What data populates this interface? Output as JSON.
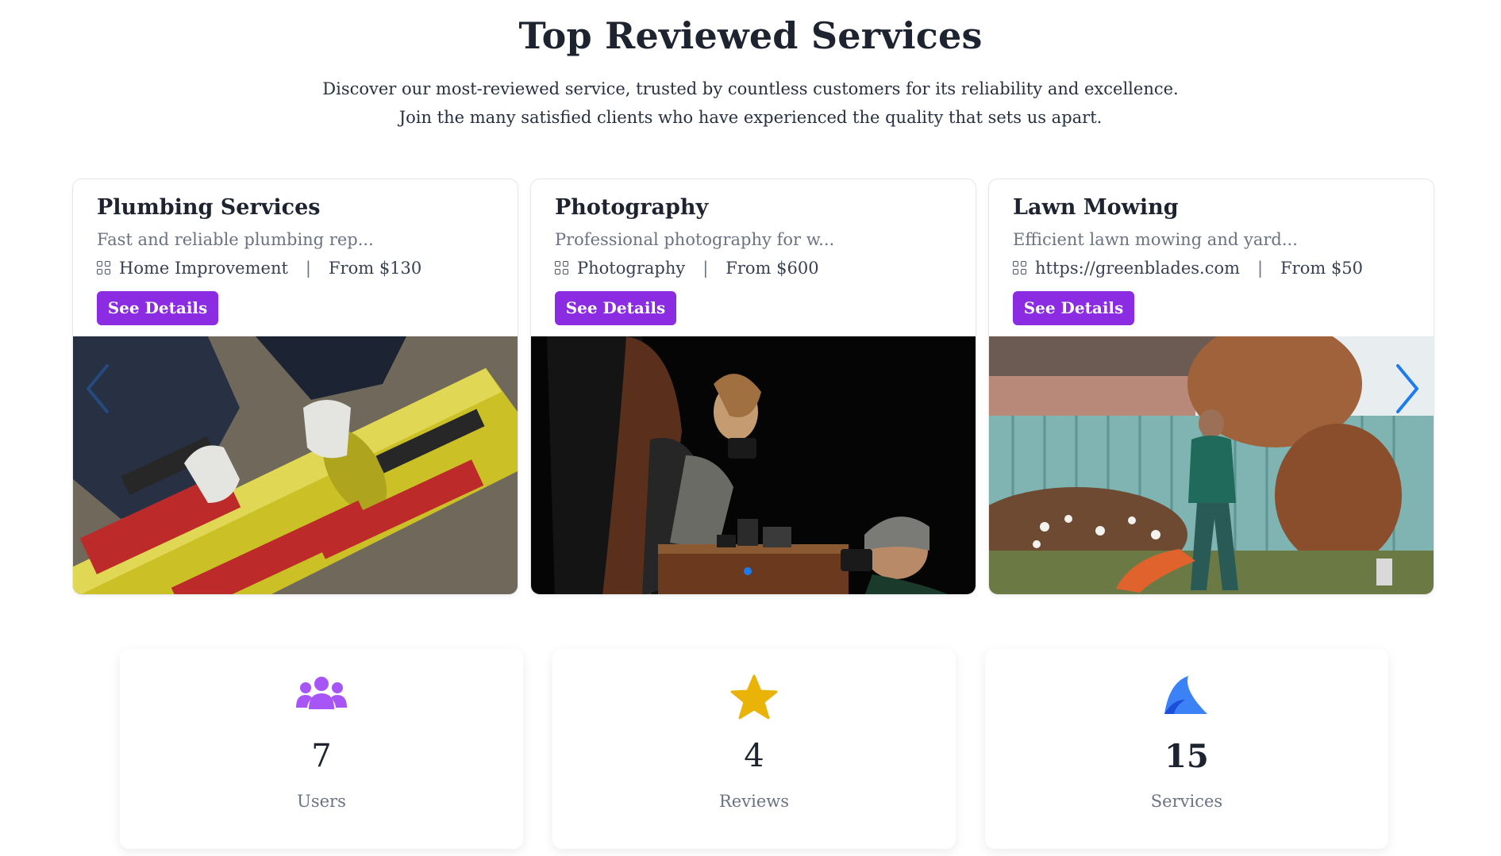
{
  "section": {
    "title": "Top Reviewed Services",
    "subtitle_line1": "Discover our most-reviewed service, trusted by countless customers for its reliability and excellence.",
    "subtitle_line2": "Join the many satisfied clients who have experienced the quality that sets us apart."
  },
  "services": [
    {
      "title": "Plumbing Services",
      "description": "Fast and reliable plumbing rep...",
      "category": "Home Improvement",
      "price": "From $130",
      "button": "See Details",
      "image": "yellow-pipe-welding-photo"
    },
    {
      "title": "Photography",
      "description": "Professional photography for w...",
      "category": "Photography",
      "price": "From $600",
      "button": "See Details",
      "image": "photographers-studio-photo"
    },
    {
      "title": "Lawn Mowing",
      "description": "Efficient lawn mowing and yard...",
      "category": "https://greenblades.com",
      "price": "From $50",
      "button": "See Details",
      "image": "man-mowing-lawn-photo"
    }
  ],
  "carousel": {
    "prev_icon": "chevron-left-icon",
    "next_icon": "chevron-right-icon",
    "active_dot_color": "#1d7bf2"
  },
  "stats": [
    {
      "icon": "users-icon",
      "value": "7",
      "label": "Users",
      "color": "#a855f7"
    },
    {
      "icon": "star-icon",
      "value": "4",
      "label": "Reviews",
      "color": "#eab308"
    },
    {
      "icon": "fin-icon",
      "value": "15",
      "label": "Services",
      "color": "#3b82f6"
    }
  ],
  "colors": {
    "accent": "#8b2be2",
    "heading": "#1e2330",
    "muted": "#6b7280"
  }
}
